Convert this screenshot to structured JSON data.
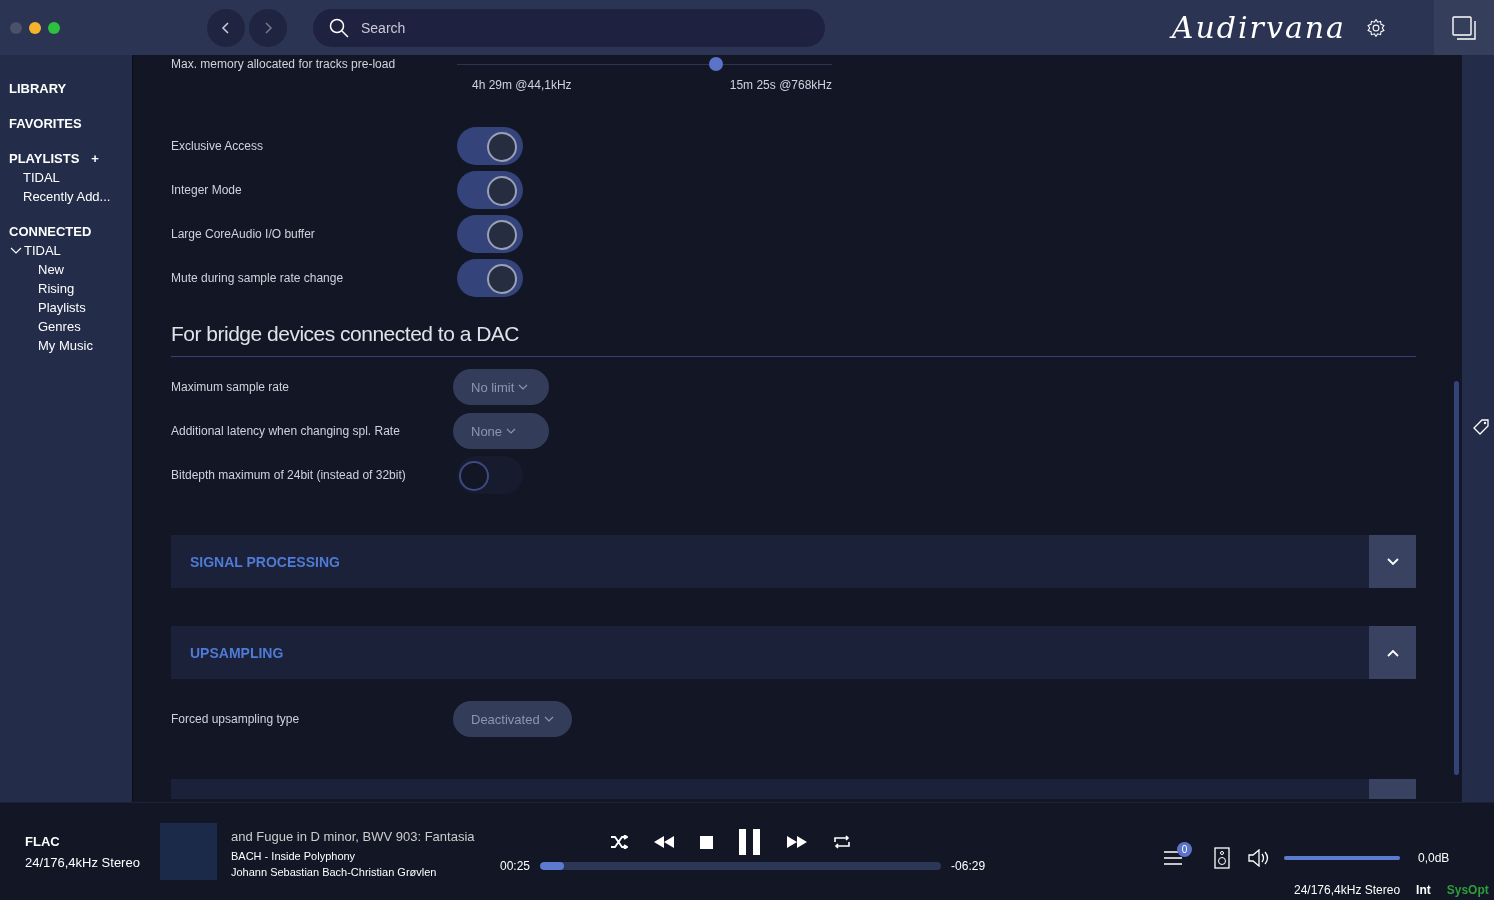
{
  "topbar": {
    "search": {
      "placeholder": "Search"
    },
    "logo": "Audirvana"
  },
  "sidebar": {
    "sections": [
      {
        "title": "LIBRARY"
      },
      {
        "title": "FAVORITES"
      },
      {
        "title": "PLAYLISTS",
        "add_label": "+",
        "items": [
          {
            "label": "TIDAL"
          },
          {
            "label": "Recently Add..."
          }
        ]
      },
      {
        "title": "CONNECTED",
        "items": [
          {
            "label": "TIDAL",
            "expanded": true,
            "children": [
              {
                "label": "New"
              },
              {
                "label": "Rising"
              },
              {
                "label": "Playlists"
              },
              {
                "label": "Genres"
              },
              {
                "label": "My Music"
              }
            ]
          }
        ]
      }
    ]
  },
  "settings": {
    "memory": {
      "label": "Max. memory allocated for tracks pre-load",
      "level": 0.69,
      "min_label": "4h 29m @44,1kHz",
      "max_label": "15m 25s @768kHz"
    },
    "toggles": [
      {
        "label": "Exclusive Access",
        "on": true
      },
      {
        "label": "Integer Mode",
        "on": true
      },
      {
        "label": "Large CoreAudio I/O buffer",
        "on": true
      },
      {
        "label": "Mute during sample rate change",
        "on": true
      }
    ],
    "bridge": {
      "heading": "For bridge devices connected to a DAC",
      "rows": [
        {
          "kind": "dropdown",
          "label": "Maximum sample rate",
          "value": "No limit"
        },
        {
          "kind": "dropdown",
          "label": "Additional latency when changing spl. Rate",
          "value": "None"
        },
        {
          "kind": "toggle",
          "label": "Bitdepth maximum of 24bit (instead of 32bit)",
          "on": false
        }
      ]
    },
    "panels": [
      {
        "title": "SIGNAL PROCESSING",
        "expanded": false
      },
      {
        "title": "UPSAMPLING",
        "expanded": true,
        "rows": [
          {
            "kind": "dropdown",
            "label": "Forced upsampling type",
            "value": "Deactivated"
          }
        ]
      }
    ]
  },
  "player": {
    "format": "FLAC",
    "quality": "24/176,4kHz Stereo",
    "title": "and Fugue in D minor, BWV 903: Fantasia",
    "album": "BACH - Inside Polyphony",
    "artist": "Johann Sebastian Bach-Christian Grøvlen",
    "elapsed": "00:25",
    "remaining": "-06:29",
    "progress": {
      "level": 0.06
    },
    "queue_count": "0",
    "volume": {
      "level": 1
    },
    "volume_reading": "0,0dB",
    "status": [
      {
        "text": "24/176,4kHz Stereo",
        "color": "#ffffff"
      },
      {
        "text": "Int",
        "color": "#ffffff"
      },
      {
        "text": "SysOpt",
        "color": "#2e9e3a"
      }
    ]
  }
}
